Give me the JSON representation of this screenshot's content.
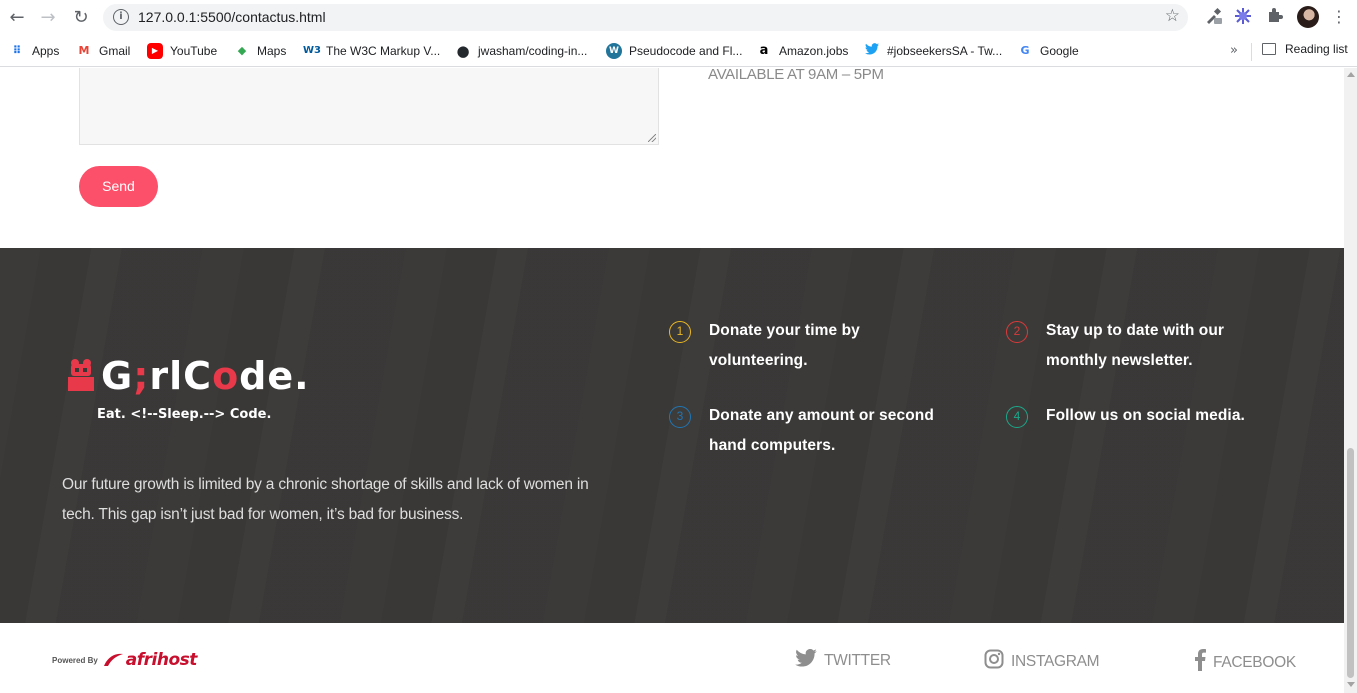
{
  "browser": {
    "url": "127.0.0.1:5500/contactus.html",
    "back_glyph": "←",
    "forward_glyph": "→",
    "reload_glyph": "↻",
    "info_glyph": "i",
    "star_glyph": "☆",
    "more_glyph": "⋮",
    "bookmarks": [
      {
        "label": "Apps",
        "icon": "apps-grid-icon",
        "glyph": "⠿",
        "color": "#1a73e8"
      },
      {
        "label": "Gmail",
        "icon": "gmail-icon",
        "glyph": "M",
        "color": "#ea4335"
      },
      {
        "label": "YouTube",
        "icon": "youtube-icon",
        "glyph": "▶",
        "color": "#ff0000"
      },
      {
        "label": "Maps",
        "icon": "maps-icon",
        "glyph": "◆",
        "color": "#34a853"
      },
      {
        "label": "The W3C Markup V...",
        "icon": "w3c-icon",
        "glyph": "W3",
        "color": "#005a9c"
      },
      {
        "label": "jwasham/coding-in...",
        "icon": "github-icon",
        "glyph": "●",
        "color": "#24292e"
      },
      {
        "label": "Pseudocode and Fl...",
        "icon": "wordpress-icon",
        "glyph": "W",
        "color": "#21759b"
      },
      {
        "label": "Amazon.jobs",
        "icon": "amazon-icon",
        "glyph": "a",
        "color": "#000000"
      },
      {
        "label": "#jobseekersSA - Tw...",
        "icon": "twitter-icon",
        "glyph": "🐦",
        "color": "#1da1f2"
      },
      {
        "label": "Google",
        "icon": "google-icon",
        "glyph": "G",
        "color": "#4285f4"
      }
    ],
    "bookmarks_more": "»",
    "reading_list": "Reading list"
  },
  "contact": {
    "availability": "AVAILABLE AT 9AM – 5PM",
    "send_label": "Send"
  },
  "footer": {
    "logo_prefix": "G",
    "logo_i": ";",
    "logo_mid": "rlC",
    "logo_o": "o",
    "logo_suffix": "de.",
    "logo_tagline": "Eat. <!--Sleep.--> Code.",
    "mission": "Our future growth is limited by a chronic shortage of skills and lack of women in tech. This gap isn’t just bad for women, it’s bad for business.",
    "items": [
      {
        "num": "1",
        "text": "Donate your time by volunteering.",
        "color": "#e9b824"
      },
      {
        "num": "2",
        "text": "Stay up to date with our monthly newsletter.",
        "color": "#d93a3a"
      },
      {
        "num": "3",
        "text": "Donate any amount or second hand computers.",
        "color": "#1f76b4"
      },
      {
        "num": "4",
        "text": "Follow us on social media.",
        "color": "#1aa88a"
      }
    ]
  },
  "bottom": {
    "powered_by": "Powered By",
    "brand_afri": "afri",
    "brand_host": "host",
    "social": [
      {
        "label": "TWITTER",
        "icon": "twitter-icon"
      },
      {
        "label": "INSTAGRAM",
        "icon": "instagram-icon"
      },
      {
        "label": "FACEBOOK",
        "icon": "facebook-icon"
      }
    ]
  },
  "colors": {
    "accent": "#fb4f6a",
    "footer_bg": "#3a3837"
  }
}
